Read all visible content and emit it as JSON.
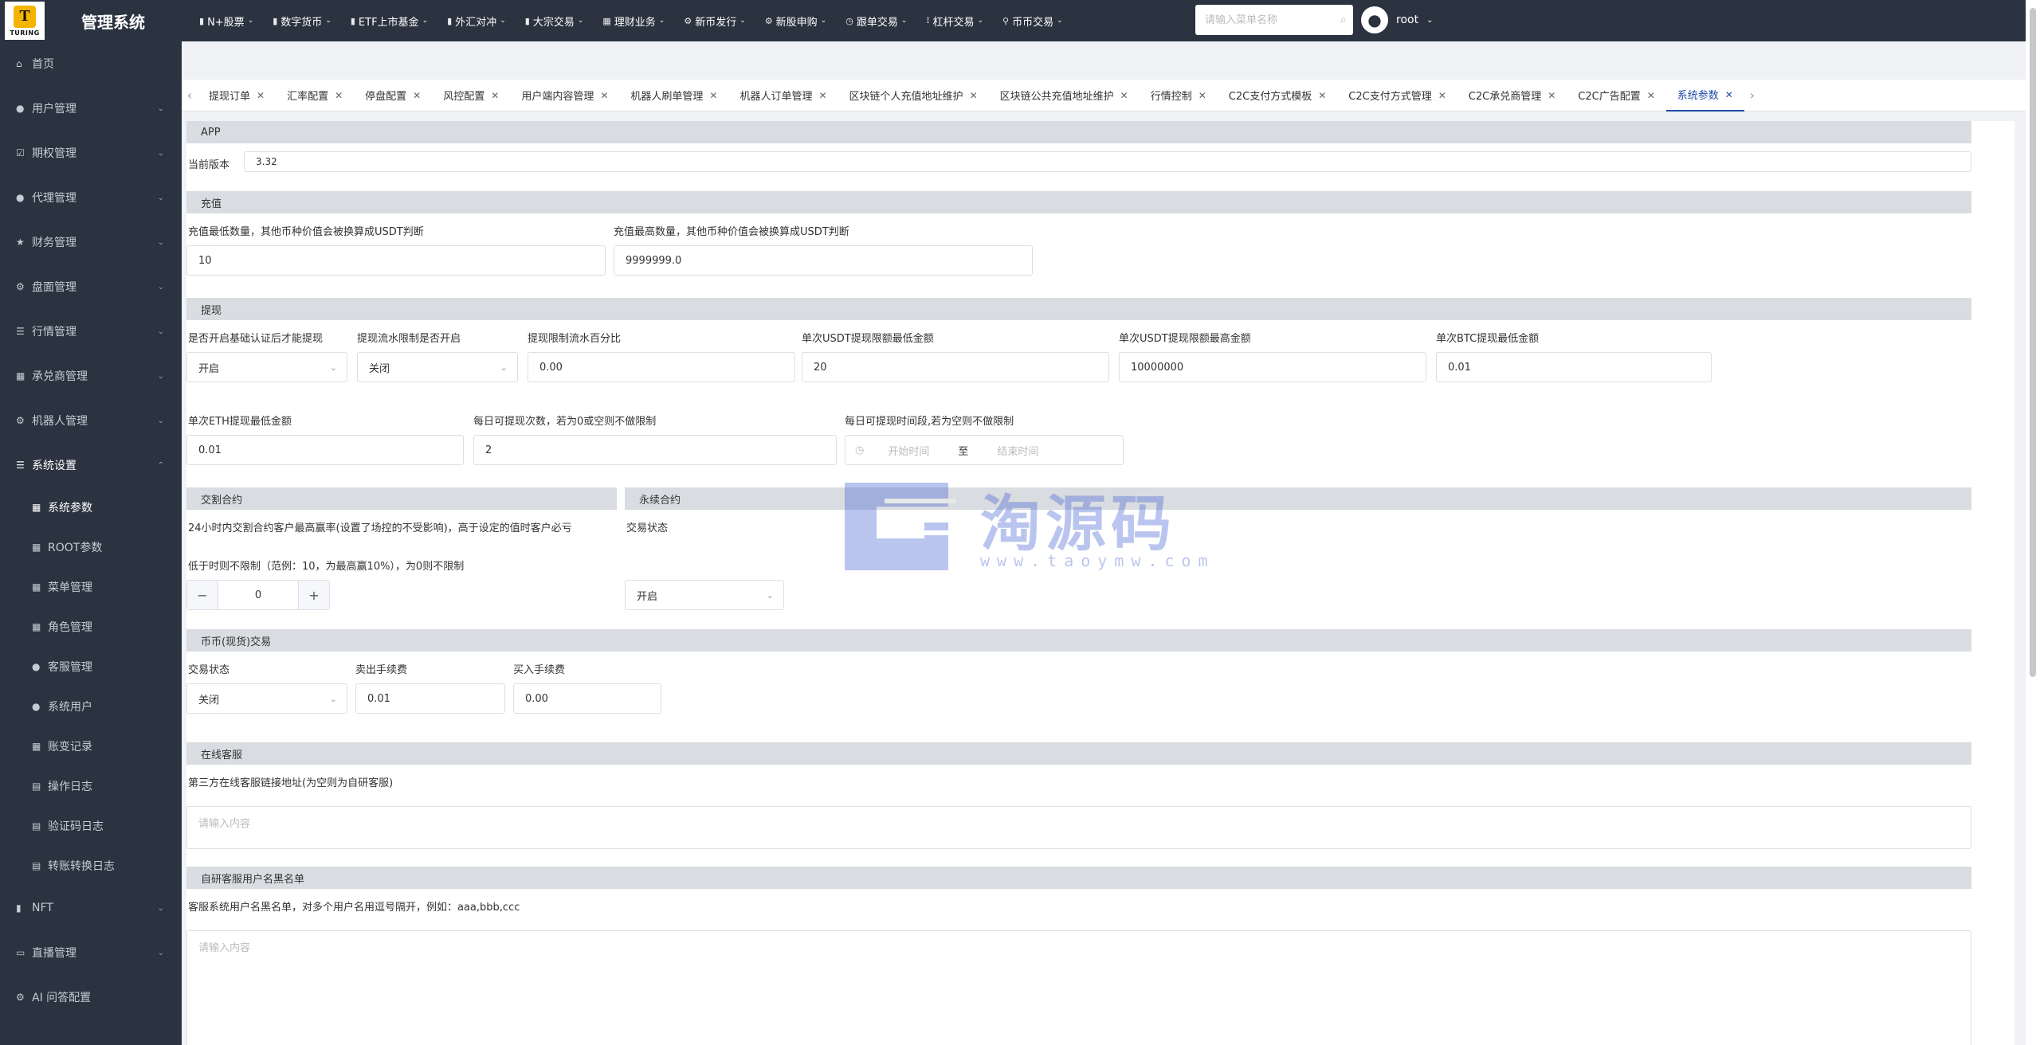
{
  "app": {
    "logo_text": "TURING",
    "logo_mark": "T",
    "title": "管理系统"
  },
  "topnav": [
    {
      "icon": "chart-icon",
      "label": "N+股票"
    },
    {
      "icon": "chart-icon",
      "label": "数字货币"
    },
    {
      "icon": "chart-icon",
      "label": "ETF上市基金"
    },
    {
      "icon": "chart-icon",
      "label": "外汇对冲"
    },
    {
      "icon": "chart-icon",
      "label": "大宗交易"
    },
    {
      "icon": "grid-icon",
      "label": "理财业务"
    },
    {
      "icon": "gear-icon",
      "label": "新币发行"
    },
    {
      "icon": "gear-icon",
      "label": "新股申购"
    },
    {
      "icon": "clock-icon",
      "label": "跟单交易"
    },
    {
      "icon": "lever-icon",
      "label": "杠杆交易"
    },
    {
      "icon": "pin-icon",
      "label": "币币交易"
    }
  ],
  "search": {
    "placeholder": "请输入菜单名称"
  },
  "user": {
    "name": "root"
  },
  "sidebar": {
    "items": [
      {
        "label": "首页",
        "icon": "home-icon",
        "has_children": false
      },
      {
        "label": "用户管理",
        "icon": "user-icon",
        "has_children": true
      },
      {
        "label": "期权管理",
        "icon": "checkbox-icon",
        "has_children": true
      },
      {
        "label": "代理管理",
        "icon": "user-icon",
        "has_children": true
      },
      {
        "label": "财务管理",
        "icon": "star-icon",
        "has_children": true
      },
      {
        "label": "盘面管理",
        "icon": "gear-icon",
        "has_children": true
      },
      {
        "label": "行情管理",
        "icon": "list-icon",
        "has_children": true
      },
      {
        "label": "承兑商管理",
        "icon": "grid-icon",
        "has_children": true
      },
      {
        "label": "机器人管理",
        "icon": "gear-icon",
        "has_children": true
      },
      {
        "label": "系统设置",
        "icon": "list-icon",
        "has_children": true,
        "open": true
      }
    ],
    "sub_items": [
      {
        "label": "系统参数",
        "icon": "grid-icon",
        "active": true
      },
      {
        "label": "ROOT参数",
        "icon": "grid-icon"
      },
      {
        "label": "菜单管理",
        "icon": "grid-icon"
      },
      {
        "label": "角色管理",
        "icon": "grid-icon"
      },
      {
        "label": "客服管理",
        "icon": "user-icon"
      },
      {
        "label": "系统用户",
        "icon": "user-icon"
      },
      {
        "label": "账变记录",
        "icon": "grid-icon"
      },
      {
        "label": "操作日志",
        "icon": "doc-icon"
      },
      {
        "label": "验证码日志",
        "icon": "doc-icon"
      },
      {
        "label": "转账转换日志",
        "icon": "doc-icon"
      }
    ],
    "bottom_items": [
      {
        "label": "NFT",
        "icon": "chart-icon",
        "has_children": true
      },
      {
        "label": "直播管理",
        "icon": "video-icon",
        "has_children": true
      },
      {
        "label": "AI 问答配置",
        "icon": "gear-icon",
        "has_children": false
      }
    ]
  },
  "tabs": [
    {
      "label": "提现订单"
    },
    {
      "label": "汇率配置"
    },
    {
      "label": "停盘配置"
    },
    {
      "label": "风控配置"
    },
    {
      "label": "用户端内容管理"
    },
    {
      "label": "机器人刷单管理"
    },
    {
      "label": "机器人订单管理"
    },
    {
      "label": "区块链个人充值地址维护"
    },
    {
      "label": "区块链公共充值地址维护"
    },
    {
      "label": "行情控制"
    },
    {
      "label": "C2C支付方式模板"
    },
    {
      "label": "C2C支付方式管理"
    },
    {
      "label": "C2C承兑商管理"
    },
    {
      "label": "C2C广告配置"
    },
    {
      "label": "系统参数",
      "active": true
    }
  ],
  "sections": {
    "app": {
      "title": "APP",
      "version_label": "当前版本",
      "version_value": "3.32"
    },
    "recharge": {
      "title": "充值",
      "min_label": "充值最低数量，其他币种价值会被换算成USDT判断",
      "min_value": "10",
      "max_label": "充值最高数量，其他币种价值会被换算成USDT判断",
      "max_value": "9999999.0"
    },
    "withdraw": {
      "title": "提现",
      "kyc_label": "是否开启基础认证后才能提现",
      "kyc_value": "开启",
      "flow_limit_label": "提现流水限制是否开启",
      "flow_limit_value": "关闭",
      "flow_pct_label": "提现限制流水百分比",
      "flow_pct_value": "0.00",
      "usdt_min_label": "单次USDT提现限额最低金额",
      "usdt_min_value": "20",
      "usdt_max_label": "单次USDT提现限额最高金额",
      "usdt_max_value": "10000000",
      "btc_min_label": "单次BTC提现最低金额",
      "btc_min_value": "0.01",
      "eth_min_label": "单次ETH提现最低金额",
      "eth_min_value": "0.01",
      "daily_count_label": "每日可提现次数，若为0或空则不做限制",
      "daily_count_value": "2",
      "time_range_label": "每日可提现时间段,若为空则不做限制",
      "time_start_placeholder": "开始时间",
      "time_to": "至",
      "time_end_placeholder": "结束时间"
    },
    "delivery": {
      "title": "交割合约",
      "desc_line1": "24小时内交割合约客户最高赢率(设置了场控的不受影响)，高于设定的值时客户必亏",
      "desc_line2": "低于时则不限制（范例：10，为最高赢10%），为0则不限制",
      "value": "0",
      "minus": "−",
      "plus": "+"
    },
    "perpetual": {
      "title": "永续合约",
      "status_label": "交易状态",
      "status_value": "开启"
    },
    "spot": {
      "title": "币币(现货)交易",
      "status_label": "交易状态",
      "status_value": "关闭",
      "sell_fee_label": "卖出手续费",
      "sell_fee_value": "0.01",
      "buy_fee_label": "买入手续费",
      "buy_fee_value": "0.00"
    },
    "online_service": {
      "title": "在线客服",
      "label": "第三方在线客服链接地址(为空则为自研客服)",
      "placeholder": "请输入内容"
    },
    "blacklist": {
      "title": "自研客服用户名黑名单",
      "label": "客服系统用户名黑名单，对多个用户名用逗号隔开，例如：aaa,bbb,ccc",
      "placeholder": "请输入内容"
    }
  },
  "watermark": {
    "text": "淘源码",
    "url": "www.taoymw.com",
    "tiled_text": "taoymw.com"
  },
  "colors": {
    "topbar": "#2b3340",
    "accent": "#1f4fa8",
    "section_bar": "#d9dce0"
  }
}
